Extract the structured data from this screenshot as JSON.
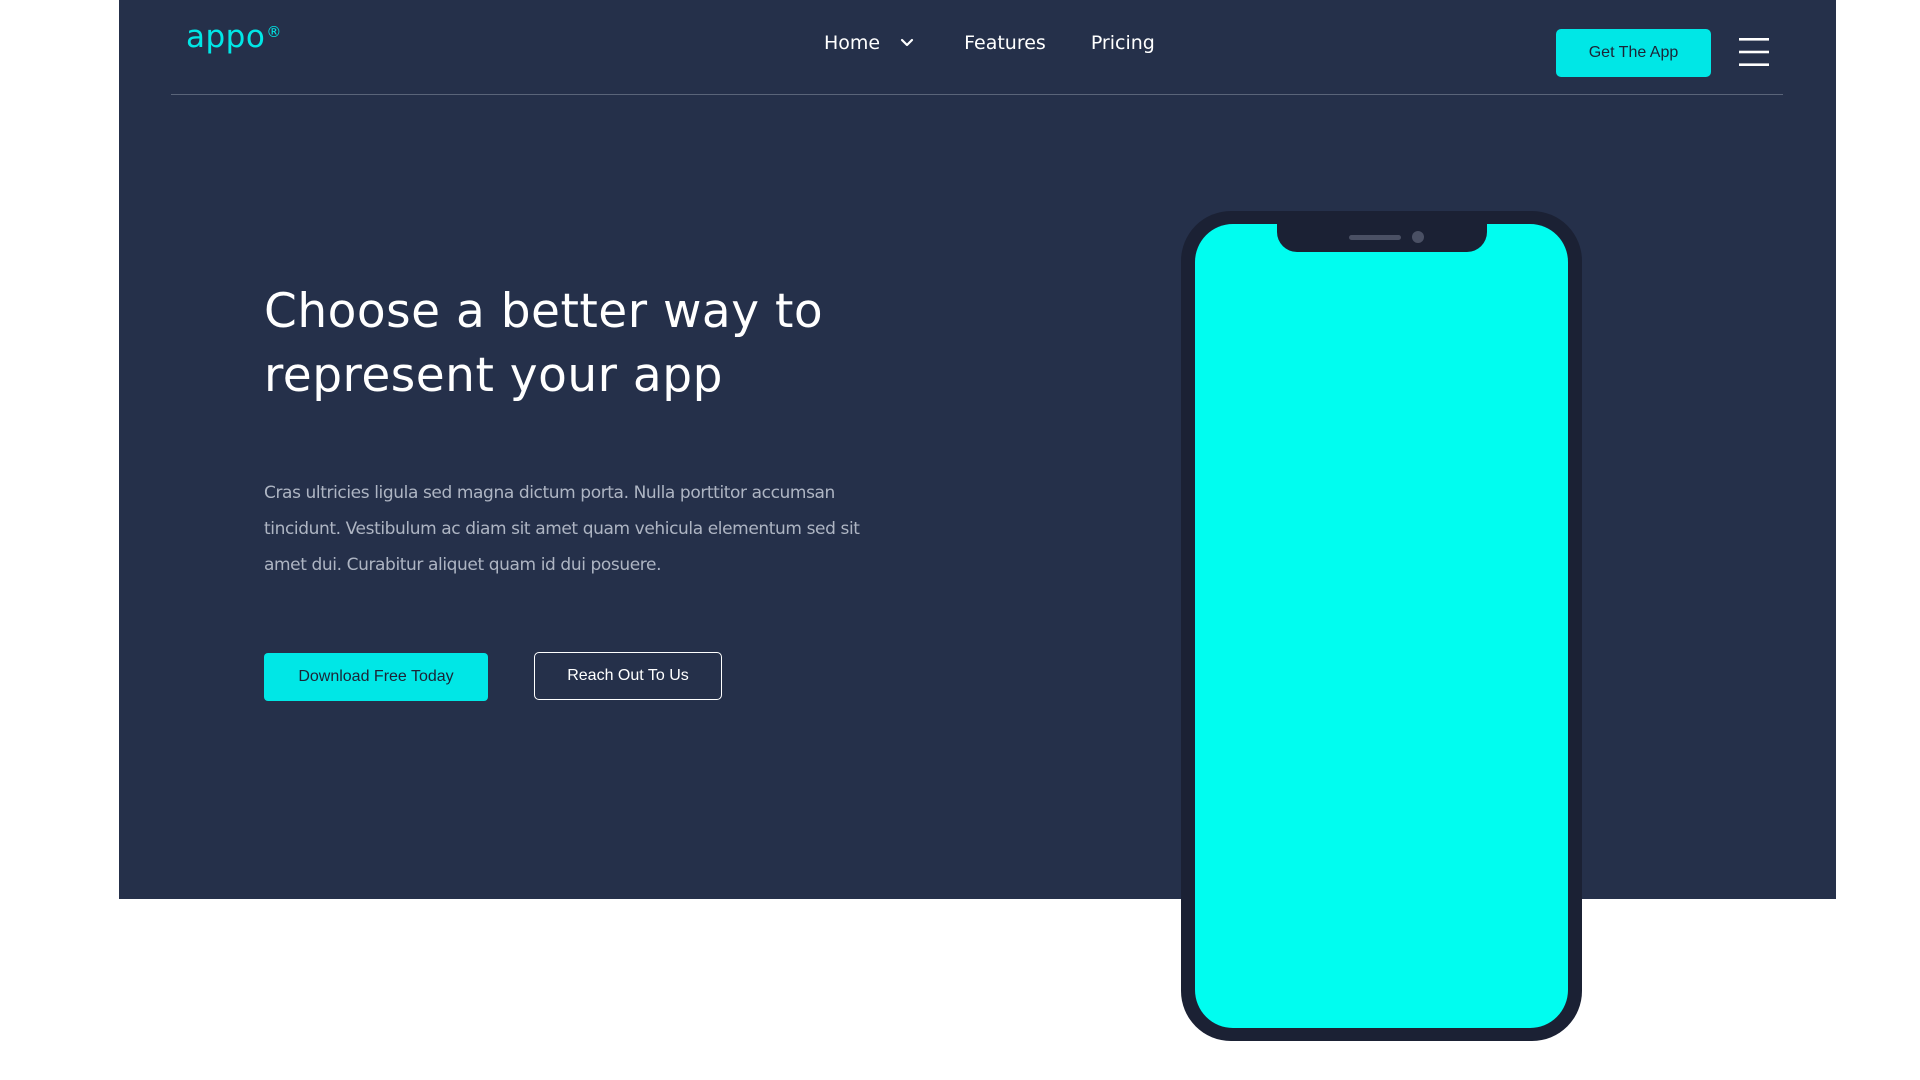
{
  "brand": {
    "name": "appo",
    "mark": "®"
  },
  "nav": {
    "items": [
      {
        "label": "Home"
      },
      {
        "label": "Features"
      },
      {
        "label": "Pricing"
      }
    ],
    "home_icon": "chevron-down-icon",
    "cta_label": "Get The App",
    "menu_icon": "hamburger-menu-icon"
  },
  "hero": {
    "headline": "Choose a better way to represent your app",
    "description": "Cras ultricies ligula sed magna dictum porta. Nulla porttitor accumsan tincidunt. Vestibulum ac diam sit amet quam vehicula elementum sed sit amet dui. Curabitur aliquet quam id dui posuere.",
    "primary_button": "Download Free Today",
    "secondary_button": "Reach Out To Us"
  },
  "colors": {
    "hero_background": "#25304a",
    "accent": "#00e7e6",
    "phone_screen": "#00fdf0",
    "phone_frame": "#1b2134"
  }
}
